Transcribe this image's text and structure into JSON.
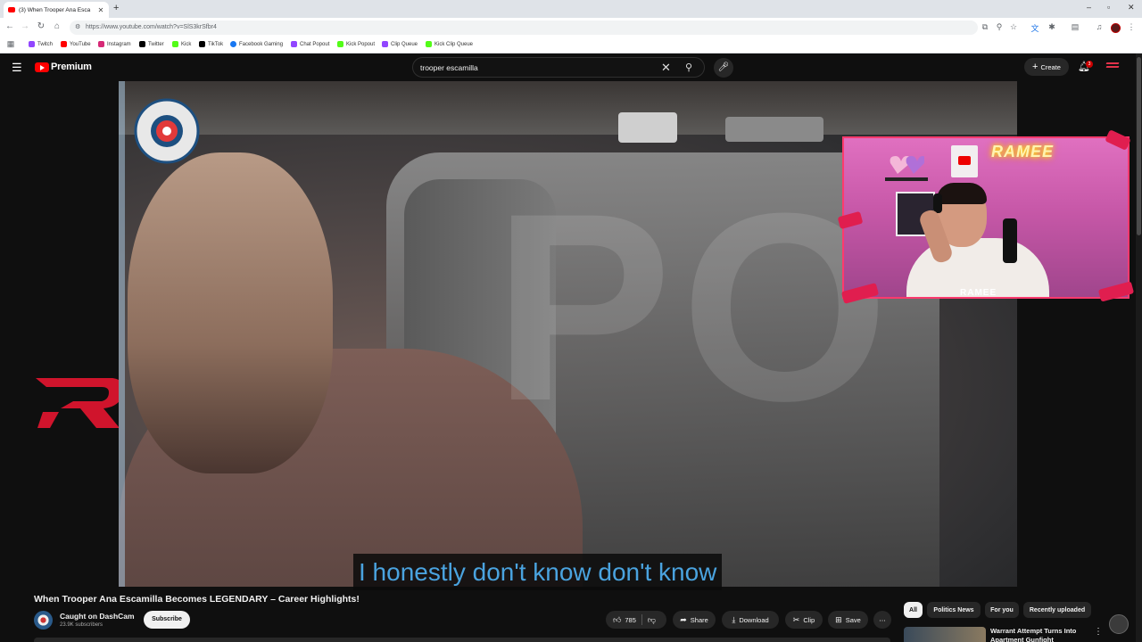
{
  "browser": {
    "tab_title": "(3) When Trooper Ana Esca",
    "url": "https://www.youtube.com/watch?v=SlS3krSfbr4",
    "bookmarks": [
      {
        "label": "Twitch",
        "color": "#9146ff"
      },
      {
        "label": "YouTube",
        "color": "#ff0000"
      },
      {
        "label": "Instagram",
        "color": "#d62976"
      },
      {
        "label": "Twitter",
        "color": "#000000"
      },
      {
        "label": "Kick",
        "color": "#53fc18"
      },
      {
        "label": "TikTok",
        "color": "#000000"
      },
      {
        "label": "Facebook Gaming",
        "color": "#1877f2"
      },
      {
        "label": "Chat Popout",
        "color": "#9146ff"
      },
      {
        "label": "Kick Popout",
        "color": "#53fc18"
      },
      {
        "label": "Clip Queue",
        "color": "#9146ff"
      },
      {
        "label": "Kick Clip Queue",
        "color": "#53fc18"
      }
    ]
  },
  "youtube": {
    "logo_text": "Premium",
    "search_query": "trooper escamilla",
    "create_label": "Create",
    "notification_count": "3",
    "brand_color": "#ff0000"
  },
  "player": {
    "caption": "I honestly don't know don't know",
    "channel_logo_text": "CAUGHT ON DASHCAM"
  },
  "webcam": {
    "neon_sign": "RAMEE",
    "bottom_logo": "RAMEE"
  },
  "video": {
    "title": "When Trooper Ana Escamilla Becomes LEGENDARY – Career Highlights!",
    "channel_name": "Caught on DashCam",
    "subscribers": "23.9K subscribers",
    "subscribe_label": "Subscribe",
    "like_count": "785",
    "actions": {
      "share": "Share",
      "download": "Download",
      "clip": "Clip",
      "save": "Save"
    }
  },
  "chips": [
    "All",
    "Politics News",
    "For you",
    "Recently uploaded"
  ],
  "recommendation": {
    "title": "Warrant Attempt Turns Into Apartment Gunfight"
  }
}
